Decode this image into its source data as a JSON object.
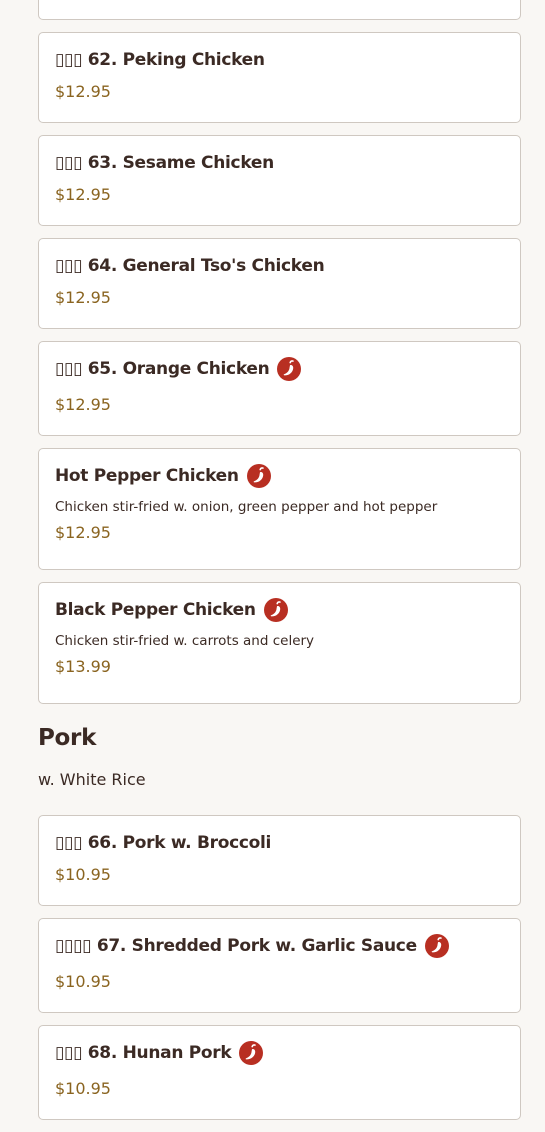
{
  "colors": {
    "background": "#f9f7f4",
    "card_border": "#cfc8c1",
    "text": "#3b2a24",
    "price": "#8a6420",
    "spicy": "#b82f22"
  },
  "chicken_items": [
    {
      "name": "▯▯▯ 62. Peking Chicken",
      "price": "$12.95",
      "spicy": false
    },
    {
      "name": "▯▯▯ 63. Sesame Chicken",
      "price": "$12.95",
      "spicy": false
    },
    {
      "name": "▯▯▯ 64. General Tso's Chicken",
      "price": "$12.95",
      "spicy": false
    },
    {
      "name": "▯▯▯ 65. Orange Chicken",
      "price": "$12.95",
      "spicy": true
    },
    {
      "name": "Hot Pepper Chicken",
      "description": "Chicken stir-fried w. onion, green pepper and hot pepper",
      "price": "$12.95",
      "spicy": true
    },
    {
      "name": "Black Pepper Chicken",
      "description": "Chicken stir-fried w. carrots and celery",
      "price": "$13.99",
      "spicy": true
    }
  ],
  "pork_section": {
    "title": "Pork",
    "subtitle": "w. White Rice"
  },
  "pork_items": [
    {
      "name": "▯▯▯ 66. Pork w. Broccoli",
      "price": "$10.95",
      "spicy": false
    },
    {
      "name": "▯▯▯▯ 67. Shredded Pork w. Garlic Sauce",
      "price": "$10.95",
      "spicy": true
    },
    {
      "name": "▯▯▯ 68. Hunan Pork",
      "price": "$10.95",
      "spicy": true
    }
  ],
  "icons": {
    "spicy": "chili-pepper-icon"
  }
}
